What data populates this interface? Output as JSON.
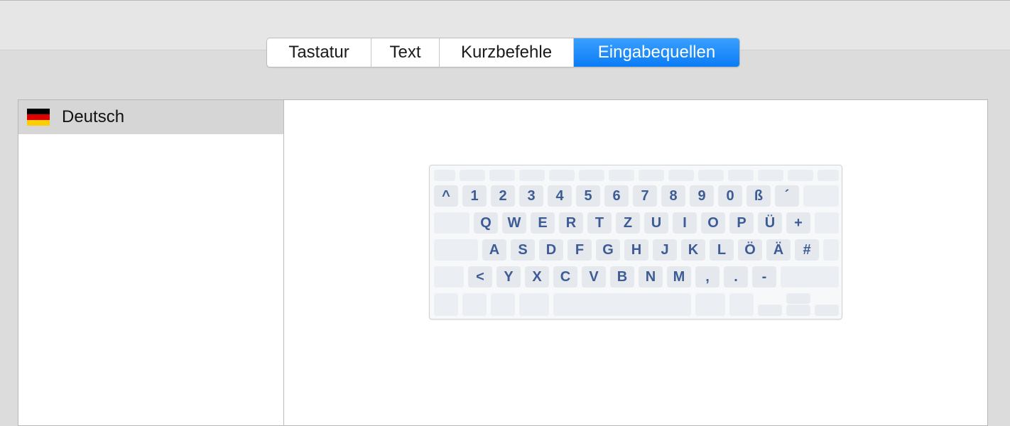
{
  "tabs": [
    {
      "label": "Tastatur",
      "active": false
    },
    {
      "label": "Text",
      "active": false
    },
    {
      "label": "Kurzbefehle",
      "active": false
    },
    {
      "label": "Eingabequellen",
      "active": true
    }
  ],
  "colors": {
    "accent": "#0a7cf5",
    "key_text": "#3d5c95",
    "key_bg": "#e5e9ee",
    "flag": [
      "#000000",
      "#dd0000",
      "#ffce00"
    ]
  },
  "input_sources": [
    {
      "label": "Deutsch",
      "icon": "german-flag-icon",
      "selected": true
    }
  ],
  "keyboard": {
    "layout_name": "German",
    "rows": [
      [
        "^",
        "1",
        "2",
        "3",
        "4",
        "5",
        "6",
        "7",
        "8",
        "9",
        "0",
        "ß",
        "´"
      ],
      [
        "Q",
        "W",
        "E",
        "R",
        "T",
        "Z",
        "U",
        "I",
        "O",
        "P",
        "Ü",
        "+"
      ],
      [
        "A",
        "S",
        "D",
        "F",
        "G",
        "H",
        "J",
        "K",
        "L",
        "Ö",
        "Ä",
        "#"
      ],
      [
        "<",
        "Y",
        "X",
        "C",
        "V",
        "B",
        "N",
        "M",
        ",",
        ".",
        "-"
      ]
    ]
  }
}
